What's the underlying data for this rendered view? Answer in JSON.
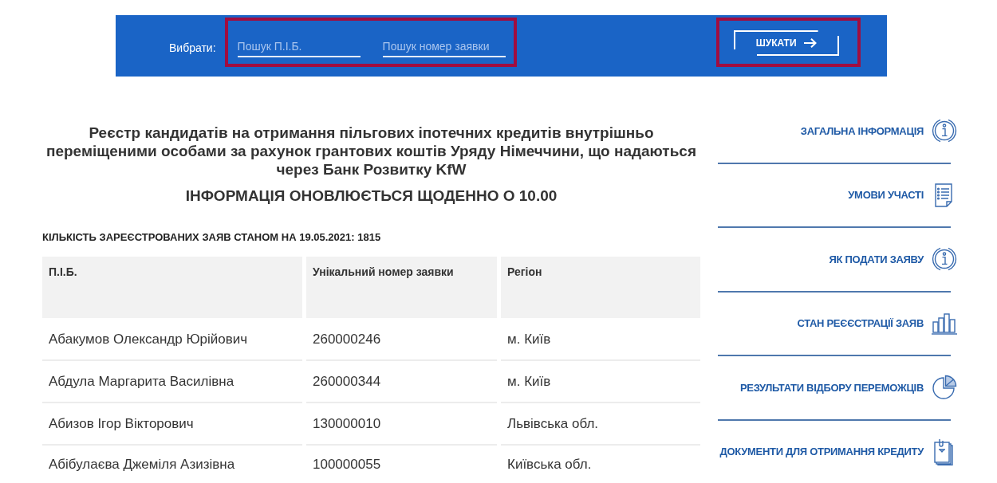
{
  "search_bar": {
    "label": "Вибрати:",
    "field_group": {
      "highlighted": true,
      "fields": [
        {
          "placeholder": "Пошук П.І.Б."
        },
        {
          "placeholder": "Пошук номер заявки"
        }
      ]
    },
    "button": {
      "label": "ШУКАТИ",
      "highlighted": true
    }
  },
  "title": "Реєстр кандидатів на отримання пільгових іпотечних кредитів внутрішньо переміщеними особами за рахунок грантових коштів Уряду Німеччини, що надаються через Банк Розвитку KfW",
  "notice": "ІНФОРМАЦІЯ ОНОВЛЮЄТЬСЯ ЩОДЕННО О 10.00",
  "count": "КІЛЬКІСТЬ ЗАРЕЄСТРОВАНИХ ЗАЯВ СТАНОМ НА 19.05.2021: 1815",
  "table": {
    "columns": [
      "П.І.Б.",
      "Унікальний номер заявки",
      "Регіон"
    ],
    "rows": [
      [
        "Абакумов Олександр Юрійович",
        "260000246",
        "м. Київ"
      ],
      [
        "Абдула Маргарита Василівна",
        "260000344",
        "м. Київ"
      ],
      [
        "Абизов Ігор Вікторович",
        "130000010",
        "Львівська обл."
      ],
      [
        "Абібулаєва Джеміля Азизівна",
        "100000055",
        "Київська обл."
      ]
    ]
  },
  "sidebar": {
    "items": [
      {
        "label": "ЗАГАЛЬНА ІНФОРМАЦІЯ",
        "kind": "info"
      },
      {
        "label": "УМОВИ УЧАСТІ",
        "kind": "list"
      },
      {
        "label": "ЯК ПОДАТИ ЗАЯВУ",
        "kind": "info"
      },
      {
        "label": "СТАН РЕЄЄСТРАЦІЇ ЗАЯВ",
        "kind": "bar_chart"
      },
      {
        "label": "РЕЗУЛЬТАТИ ВІДБОРУ ПЕРЕМОЖЦІВ",
        "kind": "pie_chart"
      },
      {
        "label": "ДОКУМЕНТИ ДЛЯ ОТРИМАННЯ КРЕДИТУ",
        "kind": "documents"
      }
    ]
  }
}
